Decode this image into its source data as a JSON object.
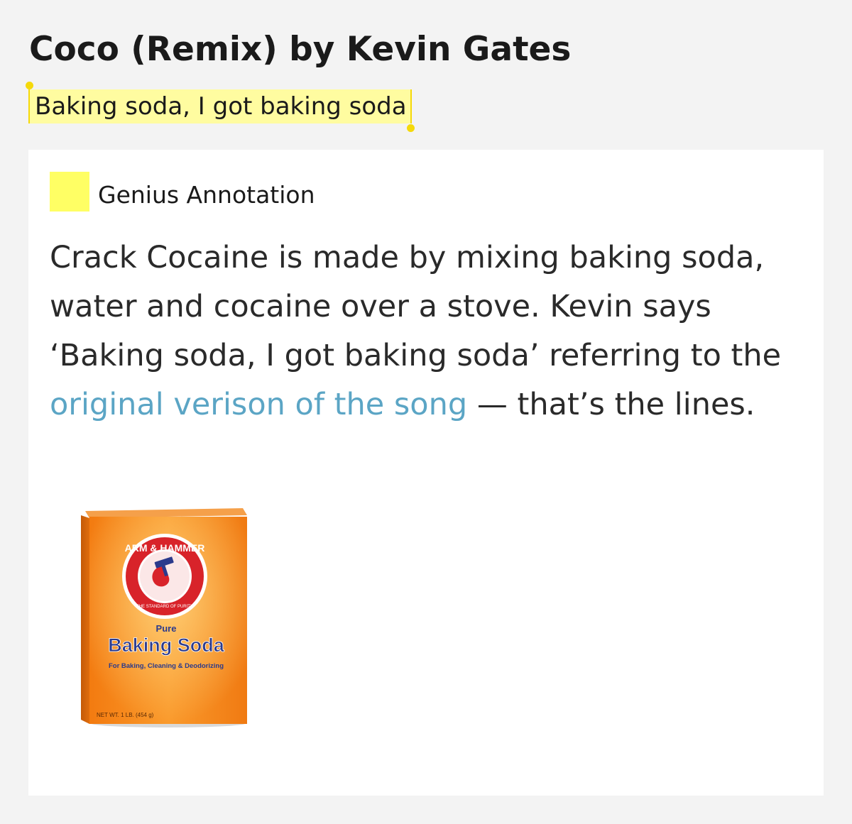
{
  "song": {
    "title": "Coco (Remix) by Kevin Gates"
  },
  "lyric": {
    "text": "Baking soda, I got baking soda"
  },
  "annotation": {
    "label": "Genius Annotation",
    "body_before": "Crack Cocaine is made by mixing baking soda, water and cocaine over a stove. Kevin says ‘Baking soda, I got baking soda’ referring to the ",
    "link_text": "original verison of the song",
    "body_after": " — that’s the lines.",
    "swatch_color": "#ffff64",
    "link_color": "#5ba5c5"
  },
  "image": {
    "brand_text": "ARM & HAMMER",
    "tagline": "THE STANDARD OF PURITY",
    "pure_label": "Pure",
    "product_name": "Baking Soda",
    "uses": "For Baking, Cleaning & Deodorizing",
    "net_weight": "NET WT. 1 LB. (454 g)"
  },
  "colors": {
    "page_background": "#f3f3f3",
    "highlight": "#fffca0",
    "highlight_handle": "#f5d90a",
    "box_orange": "#f07a12",
    "box_logo_red": "#d8232a",
    "product_text_blue": "#2b3a8c"
  }
}
